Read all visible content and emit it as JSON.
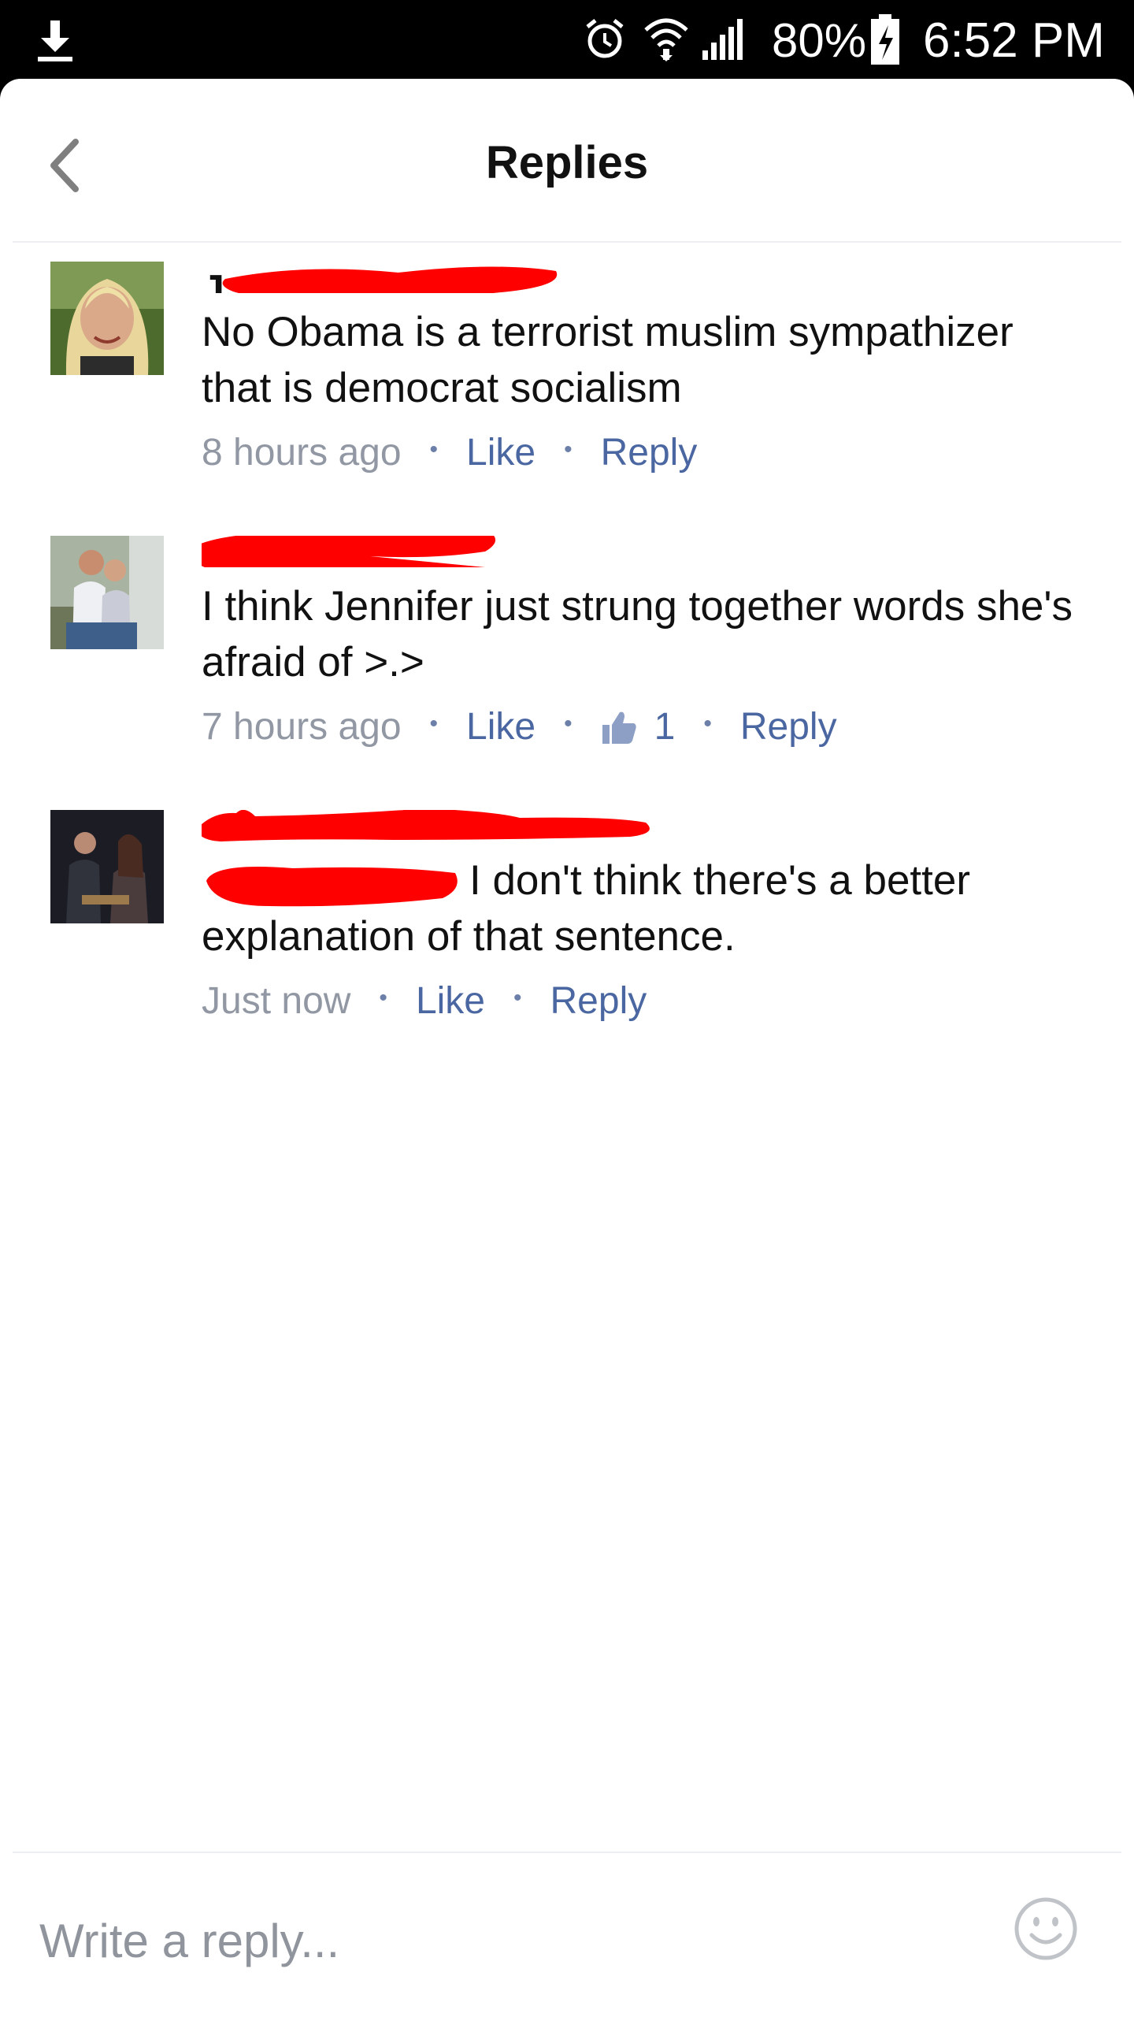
{
  "status_bar": {
    "battery_percent": "80%",
    "time": "6:52 PM",
    "icons": [
      "download-icon",
      "alarm-icon",
      "wifi-icon",
      "signal-icon",
      "battery-icon"
    ]
  },
  "header": {
    "title": "Replies",
    "back_icon": "chevron-left-icon"
  },
  "comments": [
    {
      "author_visible": "J",
      "text": "No Obama is a terrorist muslim sympathizer that is democrat socialism",
      "time": "8 hours ago",
      "like_label": "Like",
      "reply_label": "Reply",
      "likes": null
    },
    {
      "author_visible": "",
      "text": "I think Jennifer just strung together words she's afraid of >.>",
      "time": "7 hours ago",
      "like_label": "Like",
      "reply_label": "Reply",
      "likes": "1"
    },
    {
      "author_visible": "",
      "text": "I don't think there's a better explanation of that sentence.",
      "time": "Just now",
      "like_label": "Like",
      "reply_label": "Reply",
      "likes": null
    }
  ],
  "composer": {
    "placeholder": "Write a reply...",
    "emoji_icon": "smiley-icon"
  },
  "colors": {
    "link": "#4b67a1",
    "meta": "#9197a3",
    "redaction": "#ff0000"
  }
}
